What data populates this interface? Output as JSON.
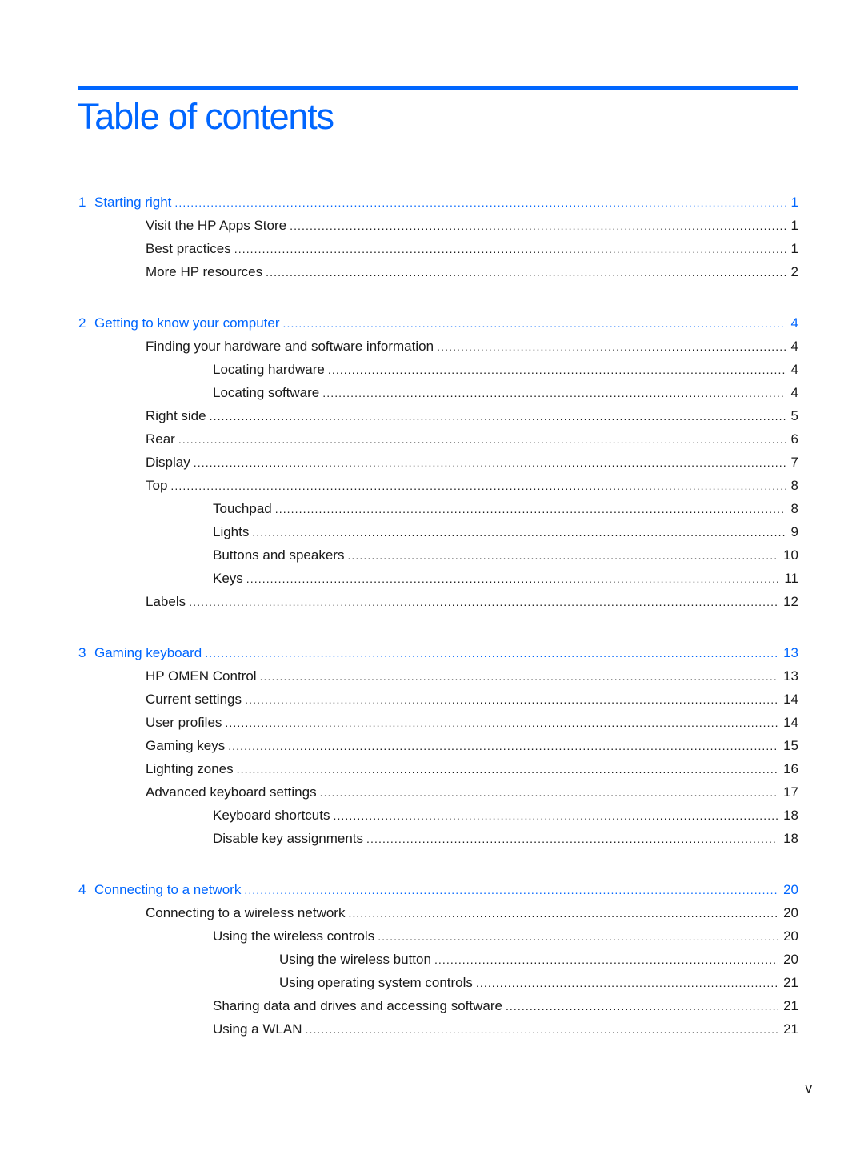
{
  "header": {
    "title": "Table of contents",
    "accent_color": "#0066ff"
  },
  "chapters": [
    {
      "number": "1",
      "title": "Starting right",
      "page": "1",
      "entries": [
        {
          "level": 1,
          "title": "Visit the HP Apps Store",
          "page": "1"
        },
        {
          "level": 1,
          "title": "Best practices",
          "page": "1"
        },
        {
          "level": 1,
          "title": "More HP resources",
          "page": "2"
        }
      ]
    },
    {
      "number": "2",
      "title": "Getting to know your computer",
      "page": "4",
      "entries": [
        {
          "level": 1,
          "title": "Finding your hardware and software information",
          "page": "4"
        },
        {
          "level": 2,
          "title": "Locating hardware",
          "page": "4"
        },
        {
          "level": 2,
          "title": "Locating software",
          "page": "4"
        },
        {
          "level": 1,
          "title": "Right side",
          "page": "5"
        },
        {
          "level": 1,
          "title": "Rear",
          "page": "6"
        },
        {
          "level": 1,
          "title": "Display",
          "page": "7"
        },
        {
          "level": 1,
          "title": "Top",
          "page": "8"
        },
        {
          "level": 2,
          "title": "Touchpad",
          "page": "8"
        },
        {
          "level": 2,
          "title": "Lights",
          "page": "9"
        },
        {
          "level": 2,
          "title": "Buttons and speakers",
          "page": "10"
        },
        {
          "level": 2,
          "title": "Keys",
          "page": "11"
        },
        {
          "level": 1,
          "title": "Labels",
          "page": "12"
        }
      ]
    },
    {
      "number": "3",
      "title": "Gaming keyboard",
      "page": "13",
      "entries": [
        {
          "level": 1,
          "title": "HP OMEN Control",
          "page": "13"
        },
        {
          "level": 1,
          "title": "Current settings",
          "page": "14"
        },
        {
          "level": 1,
          "title": "User profiles",
          "page": "14"
        },
        {
          "level": 1,
          "title": "Gaming keys",
          "page": "15"
        },
        {
          "level": 1,
          "title": "Lighting zones",
          "page": "16"
        },
        {
          "level": 1,
          "title": "Advanced keyboard settings",
          "page": "17"
        },
        {
          "level": 2,
          "title": "Keyboard shortcuts",
          "page": "18"
        },
        {
          "level": 2,
          "title": "Disable key assignments",
          "page": "18"
        }
      ]
    },
    {
      "number": "4",
      "title": "Connecting to a network",
      "page": "20",
      "entries": [
        {
          "level": 1,
          "title": "Connecting to a wireless network",
          "page": "20"
        },
        {
          "level": 2,
          "title": "Using the wireless controls",
          "page": "20"
        },
        {
          "level": 3,
          "title": "Using the wireless button",
          "page": "20"
        },
        {
          "level": 3,
          "title": "Using operating system controls",
          "page": "21"
        },
        {
          "level": 2,
          "title": "Sharing data and drives and accessing software",
          "page": "21"
        },
        {
          "level": 2,
          "title": "Using a WLAN",
          "page": "21"
        }
      ]
    }
  ],
  "footer": {
    "page_number": "v"
  }
}
